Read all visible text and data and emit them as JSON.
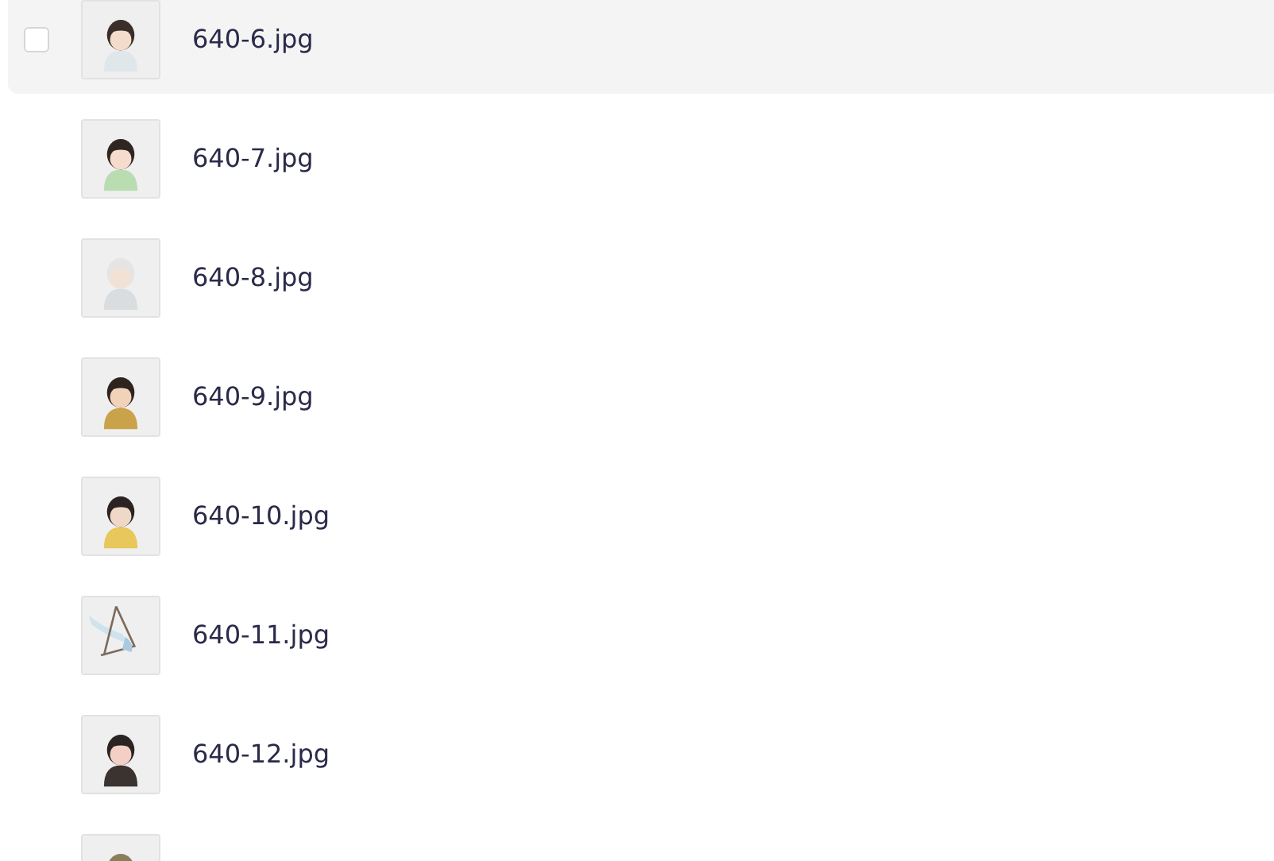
{
  "files": [
    {
      "name": "640-6.jpg",
      "hovered": true,
      "checked": false
    },
    {
      "name": "640-7.jpg",
      "hovered": false,
      "checked": false
    },
    {
      "name": "640-8.jpg",
      "hovered": false,
      "checked": false
    },
    {
      "name": "640-9.jpg",
      "hovered": false,
      "checked": false
    },
    {
      "name": "640-10.jpg",
      "hovered": false,
      "checked": false
    },
    {
      "name": "640-11.jpg",
      "hovered": false,
      "checked": false
    },
    {
      "name": "640-12.jpg",
      "hovered": false,
      "checked": false
    },
    {
      "hovered": false,
      "checked": false
    }
  ]
}
